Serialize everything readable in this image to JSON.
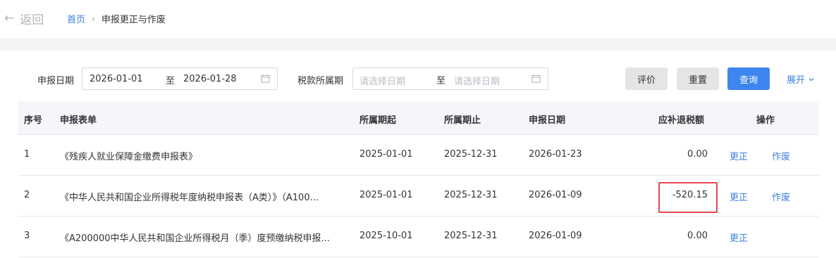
{
  "header": {
    "back_label": "返回",
    "breadcrumb_home": "首页",
    "breadcrumb_sep": "›",
    "breadcrumb_current": "申报更正与作废"
  },
  "filter": {
    "declare_date_label": "申报日期",
    "declare_date_start": "2026-01-01",
    "declare_date_to": "至",
    "declare_date_end": "2026-01-28",
    "tax_period_label": "税款所属期",
    "tax_period_start_placeholder": "请选择日期",
    "tax_period_to": "至",
    "tax_period_end_placeholder": "请选择日期",
    "evaluate_label": "评价",
    "reset_label": "重置",
    "query_label": "查询",
    "expand_label": "展开"
  },
  "table": {
    "columns": [
      "序号",
      "申报表单",
      "所属期起",
      "所属期止",
      "申报日期",
      "应补退税额",
      "操作"
    ],
    "rows": [
      {
        "index": "1",
        "form": "《残疾人就业保障金缴费申报表》",
        "period_start": "2025-01-01",
        "period_end": "2025-12-31",
        "declare_date": "2026-01-23",
        "amount": "0.00",
        "action_correct": "更正",
        "action_void": "作废"
      },
      {
        "index": "2",
        "form": "《中华人民共和国企业所得税年度纳税申报表（A类）》（A100...",
        "period_start": "2025-01-01",
        "period_end": "2025-12-31",
        "declare_date": "2026-01-09",
        "amount": "-520.15",
        "action_correct": "更正",
        "action_void": "作废"
      },
      {
        "index": "3",
        "form": "《A200000中华人民共和国企业所得税月（季）度预缴纳税申报...",
        "period_start": "2025-10-01",
        "period_end": "2025-12-31",
        "declare_date": "2026-01-09",
        "amount": "0.00",
        "action_correct": "更正"
      }
    ]
  },
  "colors": {
    "accent": "#3d86f0",
    "link": "#3d7fe0",
    "highlight": "#e5484d"
  }
}
